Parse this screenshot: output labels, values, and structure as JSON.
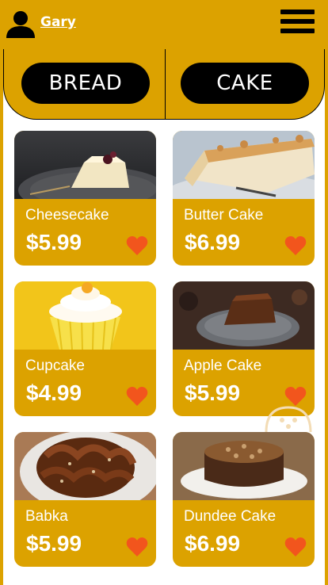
{
  "header": {
    "username": "Gary"
  },
  "tabs": [
    {
      "label": "BREAD"
    },
    {
      "label": "CAKE"
    }
  ],
  "products": [
    {
      "name": "Cheesecake",
      "price": "$5.99"
    },
    {
      "name": "Butter Cake",
      "price": "$6.99"
    },
    {
      "name": "Cupcake",
      "price": "$4.99"
    },
    {
      "name": "Apple Cake",
      "price": "$5.99"
    },
    {
      "name": "Babka",
      "price": "$5.99"
    },
    {
      "name": "Dundee Cake",
      "price": "$6.99"
    }
  ],
  "colors": {
    "accent": "#dca200",
    "heart": "#f2551d",
    "tab_bg": "#000000"
  },
  "icons": {
    "user": "user-icon",
    "menu": "hamburger-menu-icon",
    "favorite": "heart-icon"
  }
}
